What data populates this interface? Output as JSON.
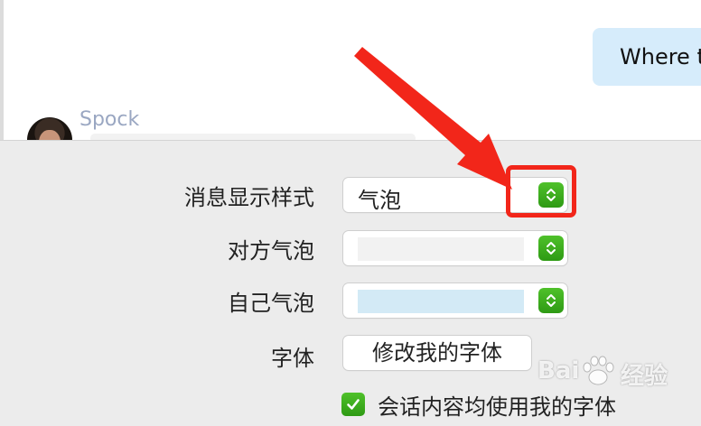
{
  "chat": {
    "outgoing_text": "Where t",
    "sender_name": "Spock"
  },
  "settings": {
    "message_style": {
      "label": "消息显示样式",
      "value": "气泡"
    },
    "their_bubble": {
      "label": "对方气泡",
      "color": "#f2f2f2"
    },
    "my_bubble": {
      "label": "自己气泡",
      "color": "#d3eaf6"
    },
    "font": {
      "label": "字体",
      "button_label": "修改我的字体"
    },
    "use_my_font": {
      "label": "会话内容均使用我的字体",
      "checked": true
    }
  },
  "colors": {
    "accent_green": "#3aae1c",
    "annotation_red": "#f2261a",
    "outgoing_bubble": "#d6ecfb",
    "sender_name": "#9aa7c2"
  },
  "watermark": {
    "brand": "Bai",
    "brand_suffix": "经验"
  }
}
